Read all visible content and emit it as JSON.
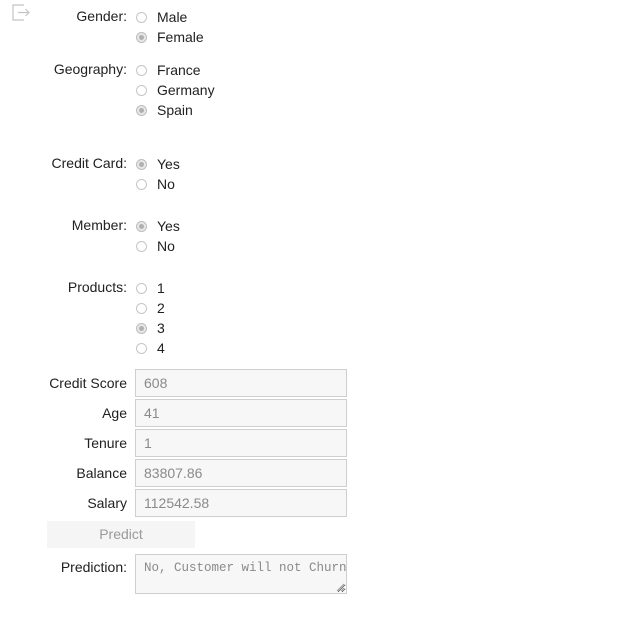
{
  "form": {
    "gender": {
      "label": "Gender:",
      "options": [
        "Male",
        "Female"
      ],
      "selected": "Female"
    },
    "geography": {
      "label": "Geography:",
      "options": [
        "France",
        "Germany",
        "Spain"
      ],
      "selected": "Spain"
    },
    "credit_card": {
      "label": "Credit Card:",
      "options": [
        "Yes",
        "No"
      ],
      "selected": "Yes"
    },
    "member": {
      "label": "Member:",
      "options": [
        "Yes",
        "No"
      ],
      "selected": "Yes"
    },
    "products": {
      "label": "Products:",
      "options": [
        "1",
        "2",
        "3",
        "4"
      ],
      "selected": "3"
    },
    "credit_score": {
      "label": "Credit Score",
      "value": "608"
    },
    "age": {
      "label": "Age",
      "value": "41"
    },
    "tenure": {
      "label": "Tenure",
      "value": "1"
    },
    "balance": {
      "label": "Balance",
      "value": "83807.86"
    },
    "salary": {
      "label": "Salary",
      "value": "112542.58"
    },
    "predict_button": "Predict",
    "prediction": {
      "label": "Prediction:",
      "value": "No, Customer will not Churn"
    }
  },
  "icons": {
    "top_left": "exit-icon"
  },
  "colors": {
    "text": "#212121",
    "input_background": "#f7f7f7",
    "input_border": "#cfcfcf",
    "input_text": "#8a8a8a",
    "button_background": "#f5f5f5",
    "button_text": "#9a9a9a"
  }
}
